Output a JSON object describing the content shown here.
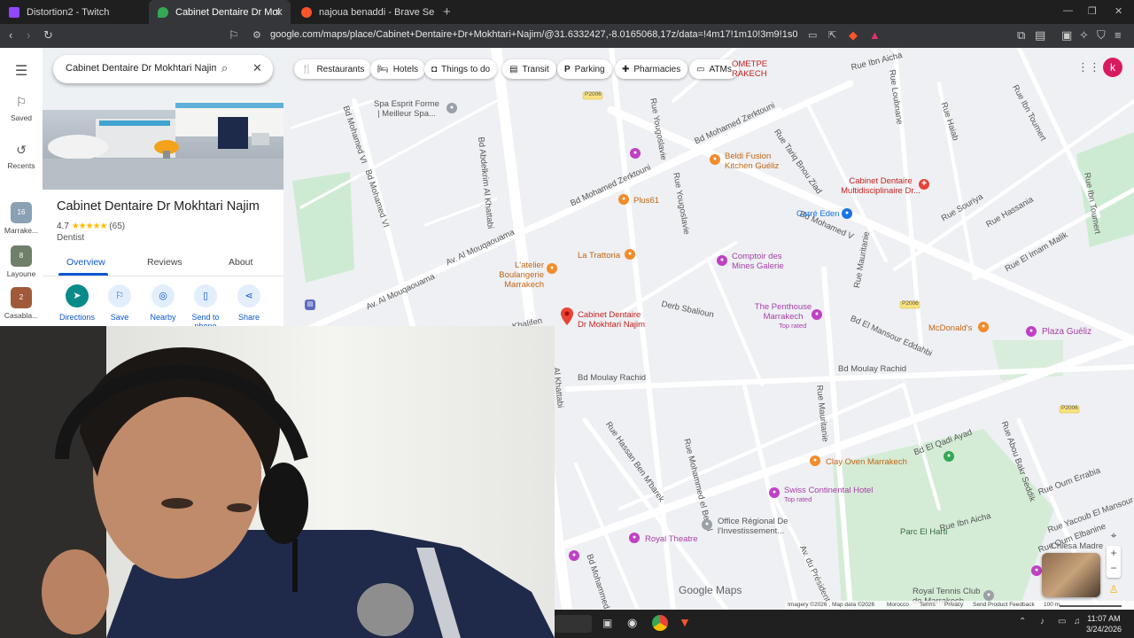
{
  "browser": {
    "tabs": [
      {
        "title": "Distortion2 - Twitch",
        "favicon_color": "#9146ff"
      },
      {
        "title": "Cabinet Dentaire Dr Mokhtari N...",
        "favicon_color": "#34a853"
      },
      {
        "title": "najoua benaddi - Brave Search",
        "favicon_color": "#fb542b"
      }
    ],
    "new_tab": "+",
    "url": "google.com/maps/place/Cabinet+Dentaire+Dr+Mokhtari+Najim/@31.6332427,-8.0165068,17z/data=!4m17!1m10!3m9!1s0xdafef5795810065:..."
  },
  "rail": {
    "menu_label": "Menu",
    "items": [
      {
        "label": "Saved",
        "icon": "bookmark-icon"
      },
      {
        "label": "Recents",
        "icon": "history-icon"
      },
      {
        "label": "Marrake...",
        "badge": "16"
      },
      {
        "label": "Layoune",
        "badge": "8"
      },
      {
        "label": "Casabla...",
        "badge": "2"
      }
    ]
  },
  "search": {
    "value": "Cabinet Dentaire Dr Mokhtari Najim"
  },
  "place": {
    "title": "Cabinet Dentaire Dr Mokhtari Najim",
    "rating": "4.7",
    "stars": "★★★★★",
    "reviews": "(65)",
    "category": "Dentist",
    "tabs": [
      "Overview",
      "Reviews",
      "About"
    ],
    "actions": [
      "Directions",
      "Save",
      "Nearby",
      "Send to phone",
      "Share"
    ]
  },
  "chips": [
    "Restaurants",
    "Hotels",
    "Things to do",
    "Transit",
    "Parking",
    "Pharmacies",
    "ATMs"
  ],
  "map": {
    "streets": [
      "Bd Abdelkrim Al Khattabi",
      "Av. Al Mouqaouama",
      "Av. Al Mouqaouama",
      "Bd Mohamed VI",
      "Bd Mohamed VI",
      "Bd Mohamed Zerktouni",
      "Bd Mohamed Zerktouni",
      "Rue Yougoslavie",
      "Rue Yougoslavie",
      "Rue Tariq Bnou Ziad",
      "Rue Loubnane",
      "Rue Ibn Toumert",
      "Rue Ibn Toumert",
      "Rue Hassania",
      "Rue Souriya",
      "Rue Haiab",
      "Bd Mohamed V",
      "Rue El Imam Malik",
      "Bd El Mansour Eddahbi",
      "Bd Moulay Rachid",
      "Bd Moulay Rachid",
      "Derb Sbalioun",
      "Rue Mauritanie",
      "Rue Mauritanie",
      "Rue Mohammed el Beqal",
      "Rue Hassan Ben M'barek",
      "Rue Ibn Aicha",
      "Rue Ibn Aicha",
      "Rue Oum Errabia",
      "Rue Yacoub El Mansour",
      "Rue Oum Elbanine",
      "Bd El Qadi Ayad",
      "Rue Abou Bakr Seddik",
      "Av. du Président",
      "Bd Mohammed VI",
      "Al Khattabi",
      "Khalifen"
    ],
    "route_badges": [
      "P2006",
      "P2006",
      "P2006"
    ],
    "pois": [
      {
        "name": "Spa Esprit Forme | Meilleur Spa...",
        "kind": "gray"
      },
      {
        "name": "Beldi Fusion Kitchen Guéliz",
        "kind": "food"
      },
      {
        "name": "Cabinet Dentaire Multidisciplinaire Dr...",
        "kind": "health"
      },
      {
        "name": "Plus61",
        "kind": "food"
      },
      {
        "name": "Carré Eden",
        "kind": "shop"
      },
      {
        "name": "La Trattoria",
        "kind": "food"
      },
      {
        "name": "Comptoir des Mines Galerie",
        "kind": "place"
      },
      {
        "name": "L'atelier Boulangerie Marrakech",
        "kind": "food"
      },
      {
        "name": "The Penthouse Marrakech",
        "kind": "place"
      },
      {
        "name": "Top rated",
        "kind": "tag"
      },
      {
        "name": "McDonald's",
        "kind": "food"
      },
      {
        "name": "Plaza Guéliz",
        "kind": "place"
      },
      {
        "name": "Clay Oven Marrakech",
        "kind": "food"
      },
      {
        "name": "Swiss Continental Hotel",
        "kind": "place"
      },
      {
        "name": "Top rated",
        "kind": "tag"
      },
      {
        "name": "Office Régional De l'Investissement...",
        "kind": "gray"
      },
      {
        "name": "Royal Theatre",
        "kind": "place"
      },
      {
        "name": "Parc El Harti",
        "kind": "gray"
      },
      {
        "name": "Royal Tennis Club de Marrakech",
        "kind": "gray"
      },
      {
        "name": "Chiesa Madre",
        "kind": "gray"
      },
      {
        "name": "ОМЕТРЕ RAKECH",
        "kind": "health"
      }
    ],
    "selected_pin": "Cabinet Dentaire Dr Mokhtari Najim",
    "logo": "Google Maps",
    "attribution": [
      "Imagery ©2026 , Map data ©2026",
      "Morocco",
      "Terms",
      "Privacy",
      "Send Product Feedback",
      "100 m"
    ]
  },
  "user_avatar": "k",
  "taskbar": {
    "time": "11:07 AM",
    "date": "3/24/2026"
  },
  "colors": {
    "accent": "#0b57d0",
    "pin": "#ea4335",
    "food": "#f28b2a",
    "place": "#c041c5"
  }
}
